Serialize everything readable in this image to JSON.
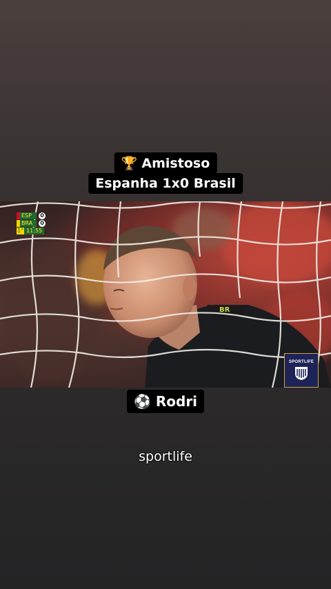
{
  "header": {
    "competition_icon": "trophy-icon",
    "competition": "Amistoso",
    "match": "Espanha 1x0 Brasil"
  },
  "scoreboard": {
    "teams": [
      {
        "code": "ESP",
        "score": "0",
        "color": "#c8102e"
      },
      {
        "code": "BRA",
        "score": "0",
        "color": "#f2d20a"
      }
    ],
    "period": "1°",
    "time": "11:55"
  },
  "player": {
    "icon": "soccer-ball-icon",
    "name": "Rodri"
  },
  "watermark": "sportlife",
  "colors": {
    "caption_bg": "#000000",
    "scoreboard_bg": "#1f6a2a",
    "badge_bg": "#1e2457"
  }
}
